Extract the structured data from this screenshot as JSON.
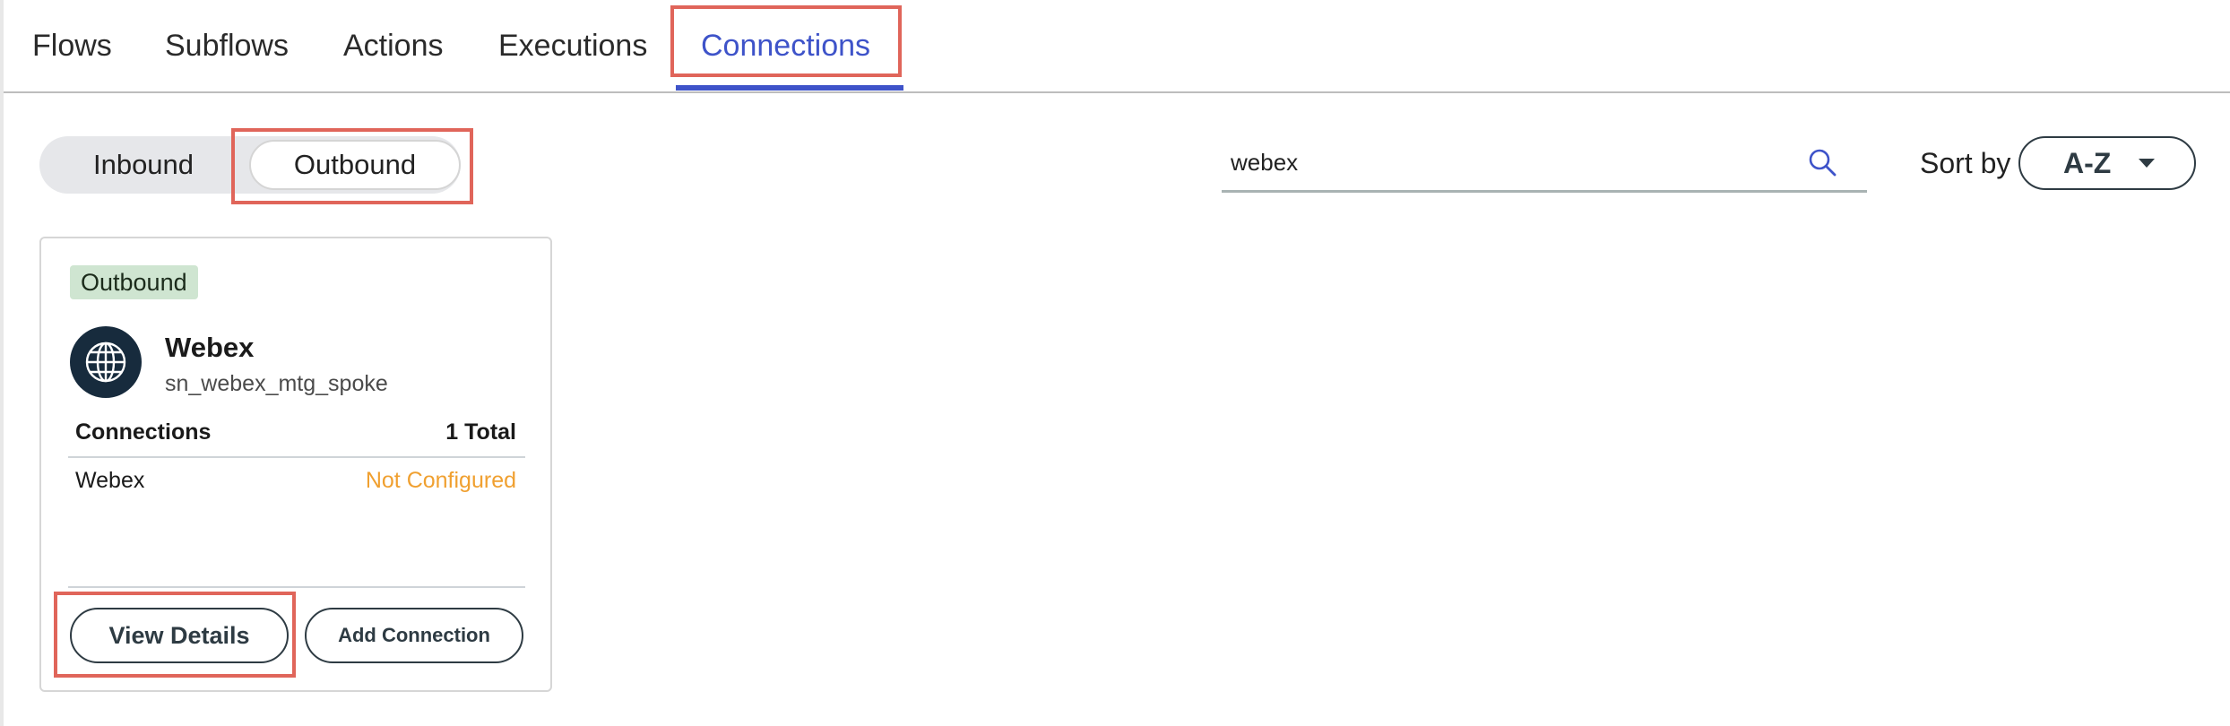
{
  "tabs": [
    {
      "label": "Flows"
    },
    {
      "label": "Subflows"
    },
    {
      "label": "Actions"
    },
    {
      "label": "Executions"
    },
    {
      "label": "Connections",
      "active": true
    }
  ],
  "direction_toggle": {
    "options": [
      "Inbound",
      "Outbound"
    ],
    "selected": "Outbound"
  },
  "search": {
    "value": "webex",
    "icon": "search-icon"
  },
  "sort": {
    "label": "Sort by",
    "value": "A-Z",
    "icon": "caret-down-icon"
  },
  "card": {
    "badge": "Outbound",
    "icon": "globe-icon",
    "title": "Webex",
    "subtitle": "sn_webex_mtg_spoke",
    "table": {
      "header_left": "Connections",
      "header_right": "1 Total",
      "rows": [
        {
          "name": "Webex",
          "status": "Not Configured"
        }
      ]
    },
    "view_details_label": "View Details",
    "add_connection_label": "Add Connection"
  },
  "colors": {
    "accent": "#3e53c9",
    "highlight": "#e0655a",
    "warning": "#f0a030",
    "badge_bg": "#cfe5d1",
    "avatar_bg": "#172b3d"
  }
}
